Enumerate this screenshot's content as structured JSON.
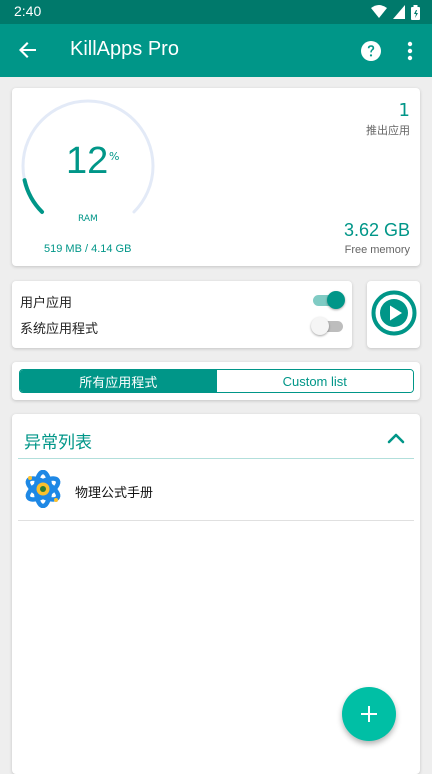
{
  "status_bar": {
    "time": "2:40",
    "icons": [
      "wifi-icon",
      "signal-icon",
      "battery-icon"
    ]
  },
  "app_bar": {
    "title": "KillApps Pro",
    "icons": {
      "back": "arrow-left-icon",
      "help": "help-circle-icon",
      "more": "more-vert-icon"
    }
  },
  "ram_card": {
    "percent": "12",
    "percent_sign": "%",
    "gauge_label": "RAM",
    "usage_text": "519 MB / 4.14 GB",
    "usage_fraction": 0.12,
    "killed_count": "1",
    "killed_label": "推出应用",
    "free_value": "3.62 GB",
    "free_label": "Free memory"
  },
  "toggles": [
    {
      "label": "用户应用",
      "on": true
    },
    {
      "label": "系统应用程式",
      "on": false
    }
  ],
  "play_button": {
    "icon": "play-circle-icon"
  },
  "segment": {
    "tabs": [
      {
        "label": "所有应用程式",
        "active": true
      },
      {
        "label": "Custom list",
        "active": false
      }
    ]
  },
  "list": {
    "header": "异常列表",
    "collapse_icon": "chevron-up-icon",
    "items": [
      {
        "name": "物理公式手册",
        "icon": "atom-icon"
      }
    ]
  },
  "fab": {
    "icon": "plus-icon"
  },
  "colors": {
    "primary": "#009688",
    "primary_dark": "#00796b",
    "accent": "#00bfa5",
    "gauge_track": "#e3eaf7"
  }
}
